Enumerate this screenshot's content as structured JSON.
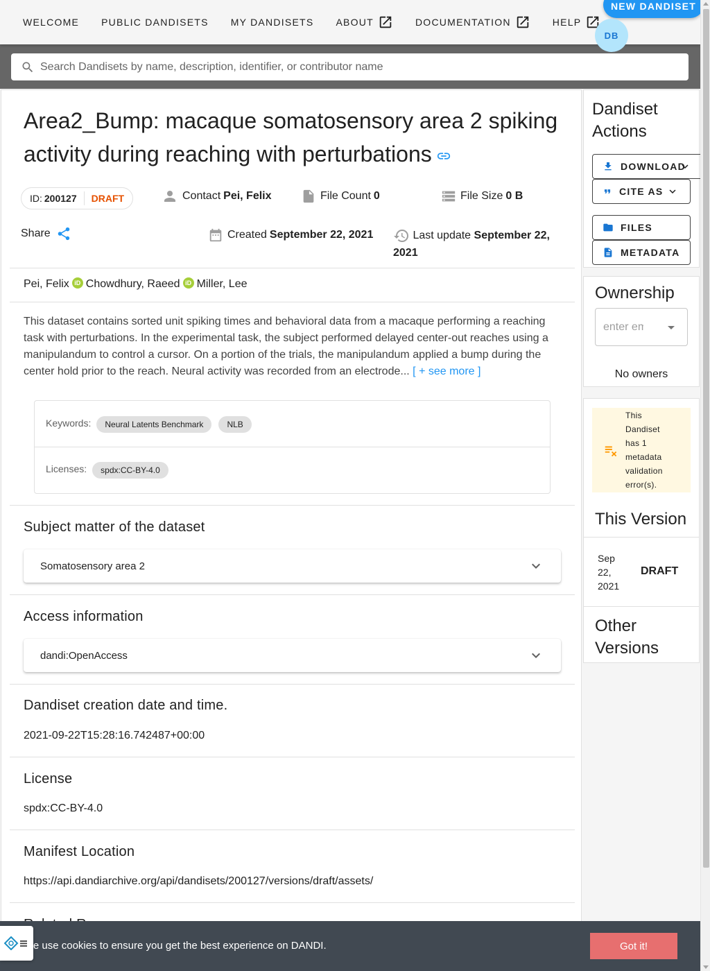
{
  "nav": {
    "items": [
      "Welcome",
      "Public Dandisets",
      "My Dandisets",
      "About",
      "Documentation",
      "Help"
    ],
    "new_dandiset": "New Dandiset",
    "avatar_initials": "DB"
  },
  "search": {
    "placeholder": "Search Dandisets by name, description, identifier, or contributor name"
  },
  "dandiset": {
    "title": "Area2_Bump: macaque somatosensory area 2 spiking activity during reaching with perturbations",
    "id_label": "ID:",
    "id": "200127",
    "status": "DRAFT",
    "contact_label": "Contact",
    "contact": "Pei, Felix",
    "file_count_label": "File Count",
    "file_count": "0",
    "file_size_label": "File Size",
    "file_size": "0 B",
    "share_label": "Share",
    "created_label": "Created",
    "created": "September 22, 2021",
    "updated_label": "Last update",
    "updated": "September 22, 2021",
    "contributors": [
      "Pei, Felix",
      "Chowdhury, Raeed",
      "Miller, Lee"
    ],
    "description": "This dataset contains sorted unit spiking times and behavioral data from a macaque performing a reaching task with perturbations. In the experimental task, the subject performed delayed center-out reaches using a manipulandum to control a cursor. On a portion of the trials, the manipulandum applied a bump during the center hold prior to the reach. Neural activity was recorded from an electrode...",
    "see_more": "[ + see more ]",
    "keywords_label": "Keywords:",
    "keywords": [
      "Neural Latents Benchmark",
      "NLB"
    ],
    "licenses_label": "Licenses:",
    "licenses": [
      "spdx:CC-BY-4.0"
    ]
  },
  "sections": {
    "subject_title": "Subject matter of the dataset",
    "subject_value": "Somatosensory area 2",
    "access_title": "Access information",
    "access_value": "dandi:OpenAccess",
    "creation_title": "Dandiset creation date and time.",
    "creation_value": "2021-09-22T15:28:16.742487+00:00",
    "license_title": "License",
    "license_value": "spdx:CC-BY-4.0",
    "manifest_title": "Manifest Location",
    "manifest_value": "https://api.dandiarchive.org/api/dandisets/200127/versions/draft/assets/",
    "related_title": "Related Resources"
  },
  "sidebar": {
    "actions_title": "Dandiset Actions",
    "download": "Download",
    "cite_as": "Cite As",
    "files": "Files",
    "metadata": "Metadata",
    "ownership_title": "Ownership",
    "owner_placeholder": "enter email",
    "no_owners": "No owners",
    "validation_warning": "This Dandiset has 1 metadata validation error(s).",
    "this_version_title": "This Version",
    "version_date": "Sep 22, 2021",
    "version_label": "DRAFT",
    "other_versions_title": "Other Versions"
  },
  "cookie": {
    "text": "We use cookies to ensure you get the best experience on DANDI.",
    "button": "Got it!"
  },
  "colors": {
    "accent": "#2196f3",
    "draft": "#e65100",
    "warning_bg": "#fff8e1",
    "cookie_bar": "#414952",
    "cookie_button": "#e76f6f"
  }
}
